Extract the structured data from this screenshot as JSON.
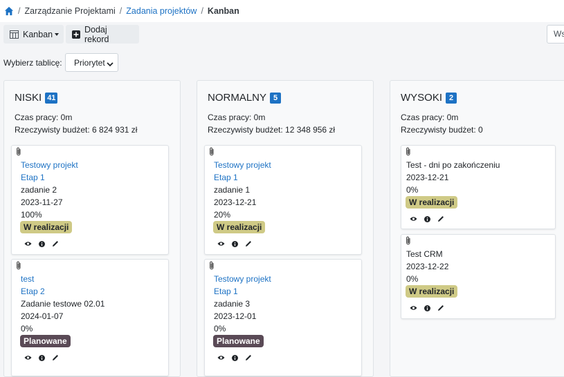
{
  "breadcrumb": {
    "item1": "Zarządzanie Projektami",
    "item2": "Zadania projektów",
    "current": "Kanban"
  },
  "toolbar": {
    "view_label": "Kanban",
    "add_label": "Dodaj rekord",
    "search_partial": "Ws"
  },
  "board": {
    "label": "Wybierz tablicę:",
    "selected": "Priorytet"
  },
  "colors": {
    "accent": "#1d72c4",
    "status_in_progress": "#cfca86",
    "status_planned": "#5a4a56"
  },
  "columns": [
    {
      "title": "NISKI",
      "count": "41",
      "work_time": "Czas pracy: 0m",
      "budget": "Rzeczywisty budżet: 6 824 931 zł",
      "cards": [
        {
          "project": "Testowy projekt",
          "stage": "Etap 1",
          "task": "zadanie 2",
          "date": "2023-11-27",
          "progress": "100%",
          "status": "W realizacji"
        },
        {
          "project": "test",
          "stage": "Etap 2",
          "task": "Zadanie testowe 02.01",
          "date": "2024-01-07",
          "progress": "0%",
          "status": "Planowane"
        }
      ]
    },
    {
      "title": "NORMALNY",
      "count": "5",
      "work_time": "Czas pracy: 0m",
      "budget": "Rzeczywisty budżet: 12 348 956 zł",
      "cards": [
        {
          "project": "Testowy projekt",
          "stage": "Etap 1",
          "task": "zadanie 1",
          "date": "2023-12-21",
          "progress": "20%",
          "status": "W realizacji"
        },
        {
          "project": "Testowy projekt",
          "stage": "Etap 1",
          "task": "zadanie 3",
          "date": "2023-12-01",
          "progress": "0%",
          "status": "Planowane"
        }
      ]
    },
    {
      "title": "WYSOKI",
      "count": "2",
      "work_time": "Czas pracy: 0m",
      "budget": "Rzeczywisty budżet: 0",
      "cards": [
        {
          "task": "Test - dni po zakończeniu",
          "date": "2023-12-21",
          "progress": "0%",
          "status": "W realizacji"
        },
        {
          "task": "Test CRM",
          "date": "2023-12-22",
          "progress": "0%",
          "status": "W realizacji"
        }
      ]
    }
  ],
  "icons": {
    "home": "home-icon",
    "board": "columns-icon",
    "add": "plus-square-icon",
    "attachment": "paperclip-icon",
    "view": "eye-icon",
    "info": "info-circle-icon",
    "edit": "pencil-icon"
  }
}
